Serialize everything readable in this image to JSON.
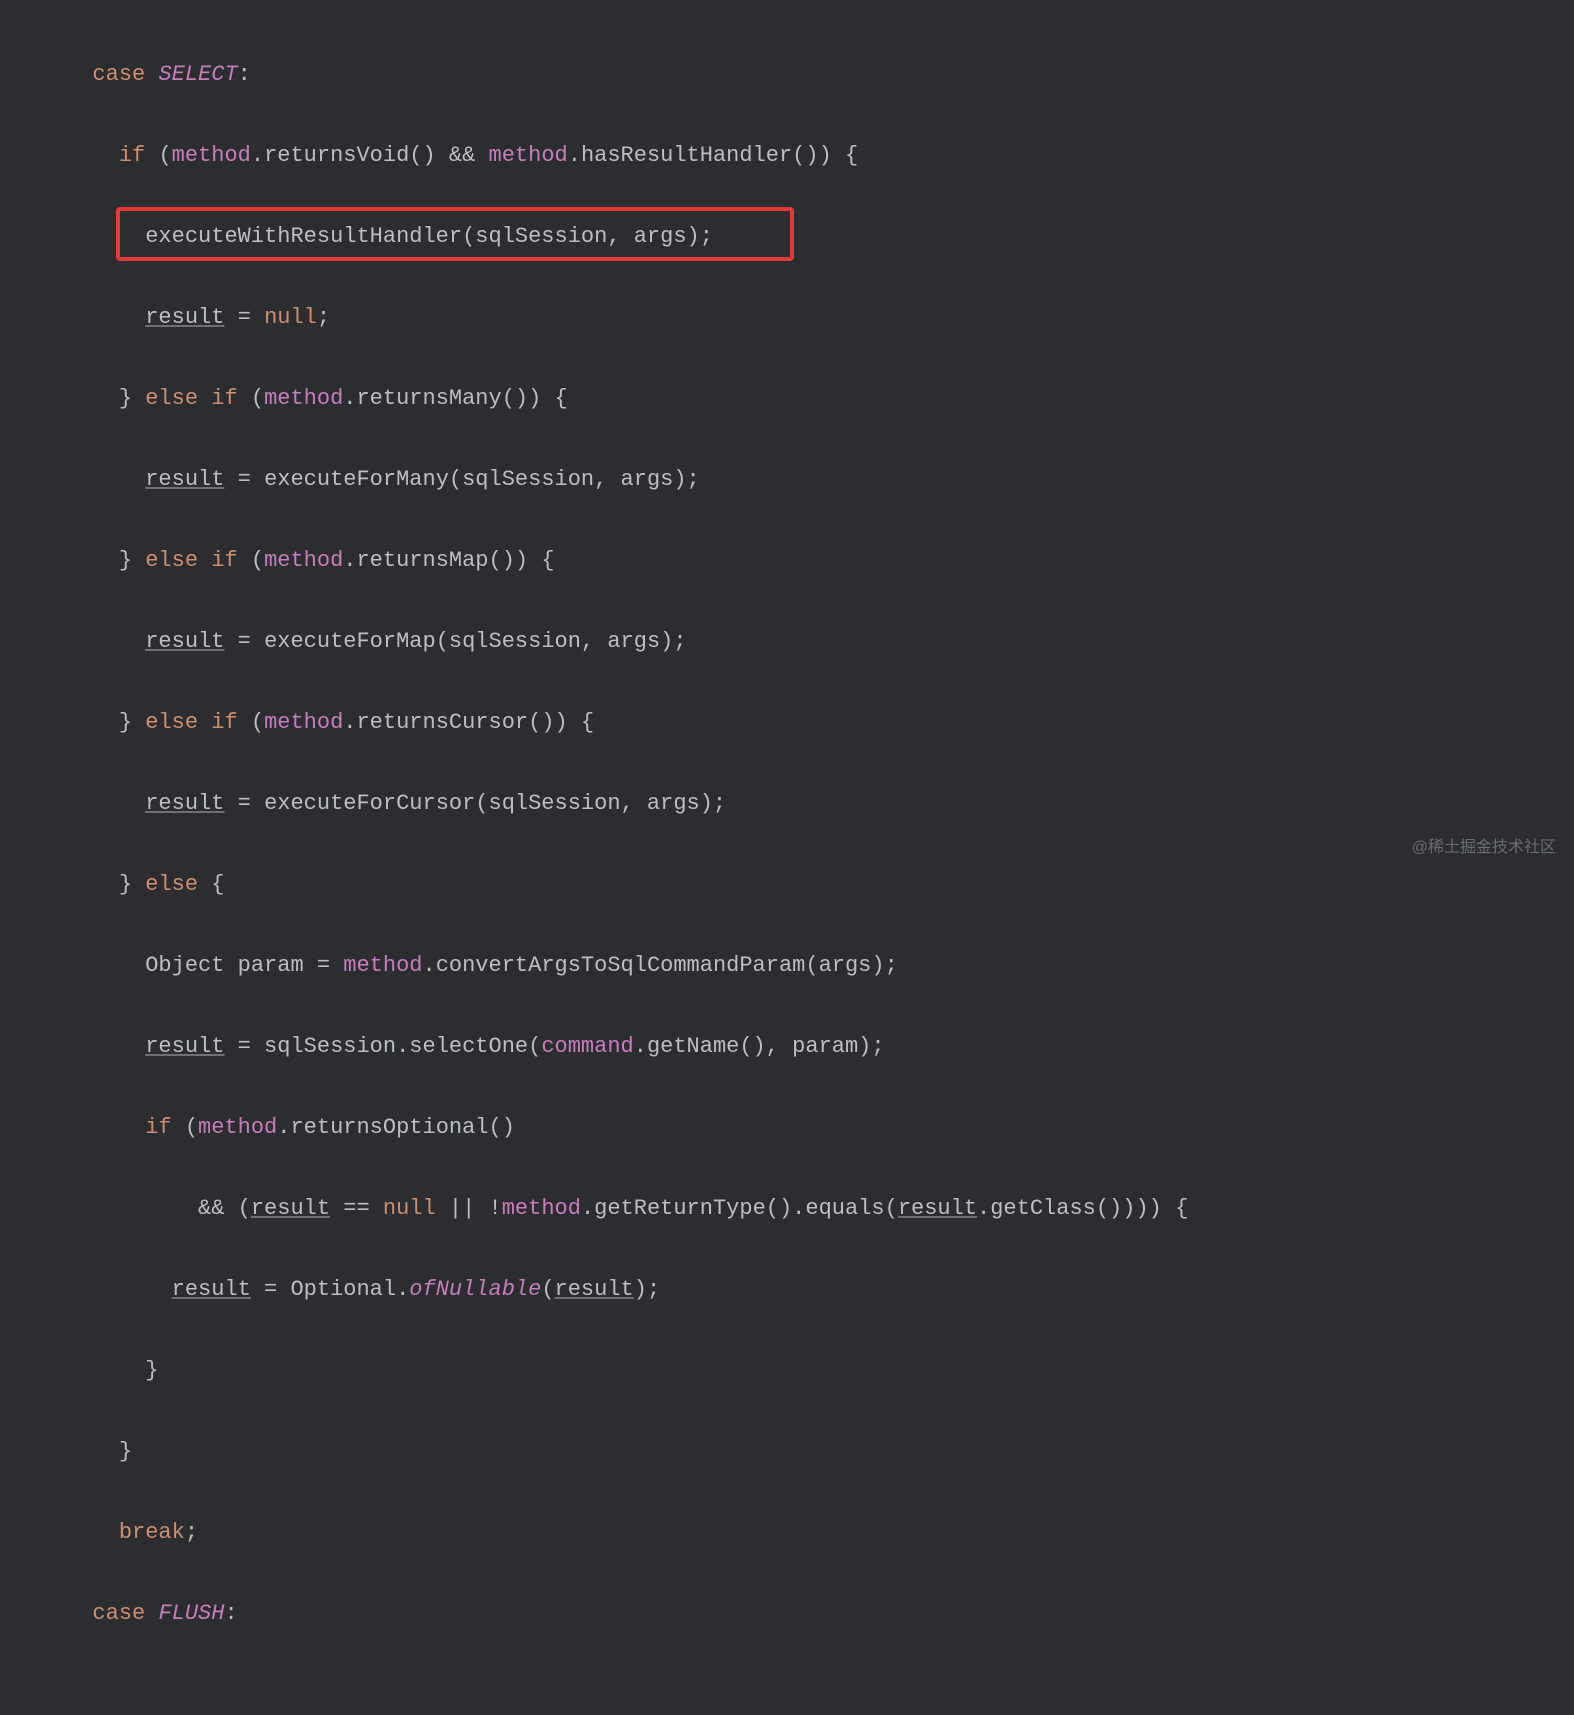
{
  "code": {
    "l1": {
      "case": "case",
      "select": "SELECT",
      "colon": ":"
    },
    "l2": {
      "if": "if",
      "op": "(",
      "method1": "method",
      "dot1": ".",
      "fn1": "returnsVoid",
      "p1": "()",
      "and": " && ",
      "method2": "method",
      "dot2": ".",
      "fn2": "hasResultHandler",
      "p2": "())",
      "brace": " {"
    },
    "l3": {
      "fn": "executeWithResultHandler",
      "args": "(sqlSession, args);"
    },
    "l4": {
      "result": "result",
      "eq": " = ",
      "null": "null",
      "semi": ";"
    },
    "l5": {
      "close": "} ",
      "else": "else if",
      "op": " (",
      "method": "method",
      "dot": ".",
      "fn": "returnsMany",
      "p": "())",
      "brace": " {"
    },
    "l6": {
      "result": "result",
      "eq": " = ",
      "fn": "executeForMany",
      "args": "(sqlSession, args);"
    },
    "l7": {
      "close": "} ",
      "else": "else if",
      "op": " (",
      "method": "method",
      "dot": ".",
      "fn": "returnsMap",
      "p": "())",
      "brace": " {"
    },
    "l8": {
      "result": "result",
      "eq": " = ",
      "fn": "executeForMap",
      "args": "(sqlSession, args);"
    },
    "l9": {
      "close": "} ",
      "else": "else if",
      "op": " (",
      "method": "method",
      "dot": ".",
      "fn": "returnsCursor",
      "p": "())",
      "brace": " {"
    },
    "l10": {
      "result": "result",
      "eq": " = ",
      "fn": "executeForCursor",
      "args": "(sqlSession, args);"
    },
    "l11": {
      "close": "} ",
      "else": "else",
      "brace": " {"
    },
    "l12": {
      "type": "Object param = ",
      "method": "method",
      "dot": ".",
      "fn": "convertArgsToSqlCommandParam",
      "args": "(args);"
    },
    "l13": {
      "result": "result",
      "eq": " = sqlSession.selectOne(",
      "command": "command",
      "dot": ".",
      "fn": "getName",
      "p": "()",
      "rest": ", param);"
    },
    "l14": {
      "if": "if",
      "op": " (",
      "method": "method",
      "dot": ".",
      "fn": "returnsOptional",
      "p": "()"
    },
    "l15": {
      "and": "&& (",
      "result": "result",
      "eqnull": " == ",
      "null": "null",
      "or": " || !",
      "method": "method",
      "dot": ".",
      "fn1": "getReturnType",
      "p1": "().",
      "fn2": "equals",
      "op": "(",
      "result2": "result",
      "dot2": ".",
      "fn3": "getClass",
      "p3": "()))) {"
    },
    "l16": {
      "result": "result",
      "eq": " = Optional.",
      "ofn": "ofNullable",
      "op": "(",
      "result2": "result",
      "close": ");"
    },
    "l17": {
      "brace": "}"
    },
    "l18": {
      "brace": "}"
    },
    "l19": {
      "break": "break",
      "semi": ";"
    },
    "l20": {
      "case": "case",
      "flush": "FLUSH",
      "colon": ":"
    }
  },
  "watermark": "@稀土掘金技术社区"
}
